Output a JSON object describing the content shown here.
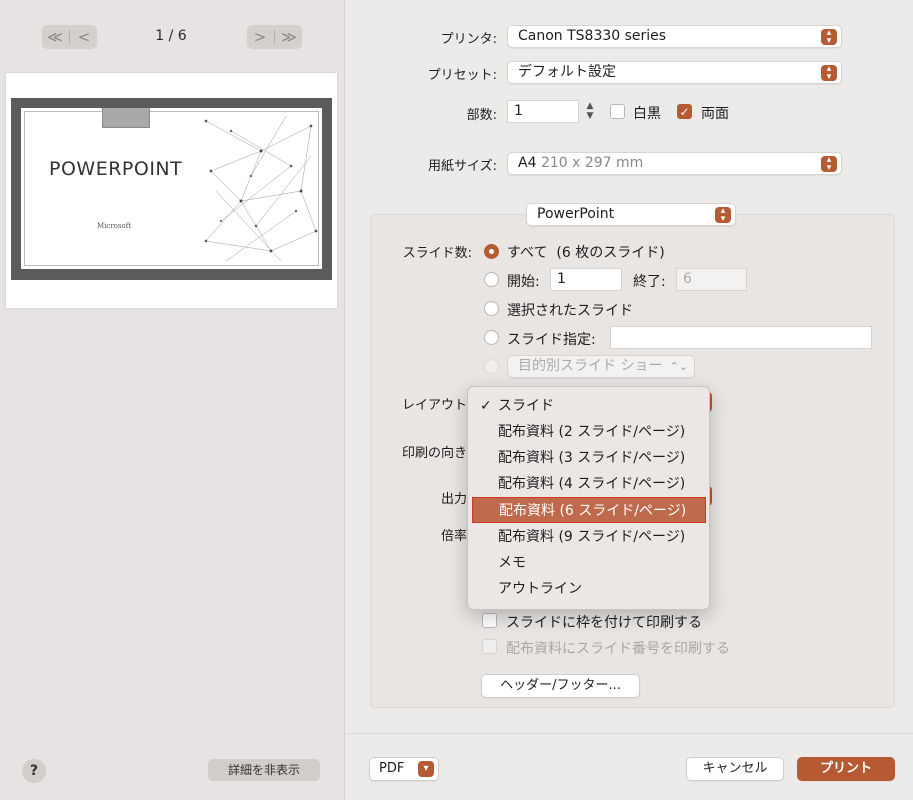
{
  "preview": {
    "page_indicator": "1 / 6",
    "first_icon": "≪",
    "prev_icon": "<",
    "next_icon": ">",
    "last_icon": "≫",
    "slide_title": "POWERPOINT",
    "slide_subtitle": "Microsoft",
    "hide_details_label": "詳細を非表示",
    "help_label": "?"
  },
  "printer": {
    "printer_label": "プリンタ:",
    "printer_value": "Canon TS8330 series",
    "preset_label": "プリセット:",
    "preset_value": "デフォルト設定",
    "copies_label": "部数:",
    "copies_value": "1",
    "bw_label": "白黒",
    "duplex_label": "両面",
    "paper_label": "用紙サイズ:",
    "paper_value": "A4",
    "paper_dims": "210 x 297 mm"
  },
  "app_section": {
    "app_value": "PowerPoint",
    "slides_label": "スライド数:",
    "all_label": "すべて",
    "all_count": "(6 枚のスライド)",
    "from_label": "開始:",
    "from_value": "1",
    "to_label": "終了:",
    "to_value": "6",
    "selected_label": "選択されたスライド",
    "custom_label": "スライド指定:",
    "custom_show_value": "目的別スライド ショー",
    "layout_label": "レイアウト",
    "orientation_label": "印刷の向き",
    "output_label": "出力",
    "scale_label": "倍率",
    "frame_label": "スライドに枠を付けて印刷する",
    "numbers_label": "配布資料にスライド番号を印刷する",
    "header_footer_label": "ヘッダー/フッター..."
  },
  "layout_menu": {
    "items": [
      "スライド",
      "配布資料 (2 スライド/ページ)",
      "配布資料 (3 スライド/ページ)",
      "配布資料 (4 スライド/ページ)",
      "配布資料 (6 スライド/ページ)",
      "配布資料 (9 スライド/ページ)",
      "メモ",
      "アウトライン"
    ],
    "checked_index": 0,
    "highlighted_index": 4,
    "check_glyph": "✓"
  },
  "footer": {
    "pdf_label": "PDF",
    "cancel_label": "キャンセル",
    "print_label": "プリント"
  },
  "colors": {
    "accent": "#b65a33",
    "menu_highlight": "#bf6a4c"
  }
}
